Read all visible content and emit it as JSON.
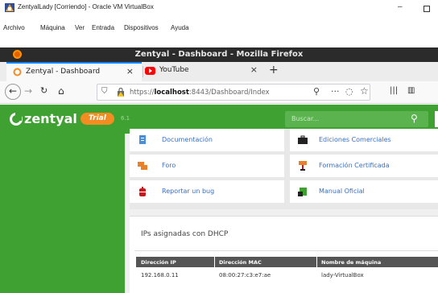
{
  "vbox": {
    "title": "ZentyalLady [Corriendo] - Oracle VM VirtualBox",
    "menu": [
      "Archivo",
      "Máquina",
      "Ver",
      "Entrada",
      "Dispositivos",
      "Ayuda"
    ]
  },
  "firefox": {
    "window_title": "Zentyal - Dashboard - Mozilla Firefox",
    "tabs": [
      {
        "label": "Zentyal - Dashboard",
        "active": true
      },
      {
        "label": "YouTube",
        "active": false
      }
    ],
    "url": {
      "prefix": "https://",
      "host": "localhost",
      "path": ":8443/Dashboard/Index"
    }
  },
  "zentyal": {
    "logo": "zentyal",
    "edition_badge": "Trial",
    "version": "6.1",
    "search_placeholder": "Buscar...",
    "links": [
      {
        "label": "Documentación",
        "icon": "document-icon",
        "color": "#4a8fd6"
      },
      {
        "label": "Ediciones Comerciales",
        "icon": "briefcase-icon",
        "color": "#222222"
      },
      {
        "label": "Foro",
        "icon": "forum-icon",
        "color": "#e8822a"
      },
      {
        "label": "Formación Certificada",
        "icon": "training-icon",
        "color": "#e8822a"
      },
      {
        "label": "Reportar un bug",
        "icon": "bug-icon",
        "color": "#c8161d"
      },
      {
        "label": "Manual Oficial",
        "icon": "manual-icon",
        "color": "#3ea131"
      }
    ],
    "dhcp": {
      "title": "IPs asignadas con DHCP",
      "columns": [
        "Dirección IP",
        "Dirección MAC",
        "Nombre de máquina"
      ],
      "rows": [
        [
          "192.168.0.11",
          "08:00:27:c3:e7:ae",
          "lady-VirtualBox"
        ]
      ]
    }
  },
  "colors": {
    "zentyal_green": "#3ea131",
    "trial_orange": "#f38c21",
    "link_blue": "#3a6fbf",
    "firefox_tab_accent": "#0a84ff"
  }
}
